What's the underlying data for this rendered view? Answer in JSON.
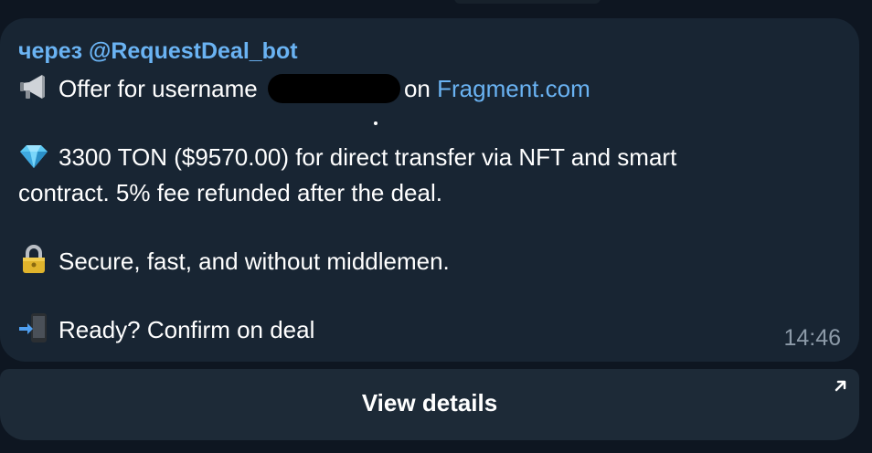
{
  "message": {
    "via": "через @RequestDeal_bot",
    "line1_prefix": "Offer for username",
    "line1_on": "on",
    "line1_link": "Fragment.com",
    "line2": "3300 TON ($9570.00) for direct transfer via NFT and smart",
    "line3": "contract. 5% fee refunded after the deal.",
    "line4": "Secure, fast, and without middlemen.",
    "line5": "Ready? Confirm on deal",
    "time": "14:46"
  },
  "button": {
    "label": "View details"
  },
  "colors": {
    "background": "#0e1621",
    "bubble": "#182533",
    "link": "#6ab3f3",
    "text": "#ffffff",
    "muted": "#8c9aa8"
  },
  "icons": [
    "megaphone-icon",
    "gem-icon",
    "lock-icon",
    "phone-arrow-icon",
    "external-arrow-icon"
  ]
}
